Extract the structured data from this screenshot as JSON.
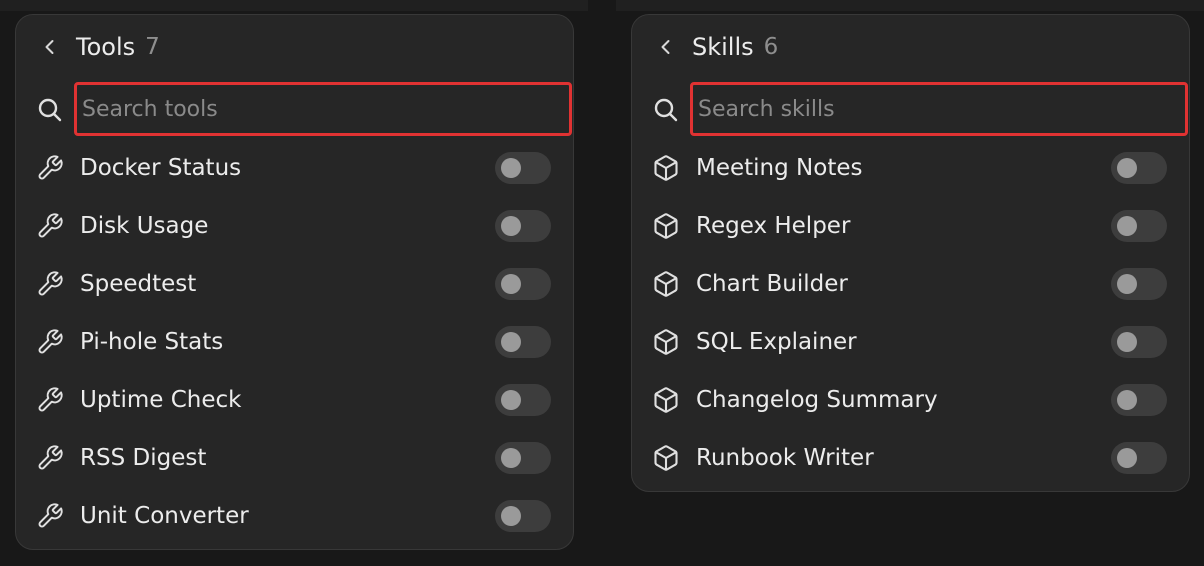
{
  "tools_panel": {
    "title": "Tools",
    "count": "7",
    "search_placeholder": "Search tools",
    "search_value": "",
    "item_icon": "wrench-icon",
    "items": [
      {
        "label": "Docker Status",
        "enabled": false
      },
      {
        "label": "Disk Usage",
        "enabled": false
      },
      {
        "label": "Speedtest",
        "enabled": false
      },
      {
        "label": "Pi-hole Stats",
        "enabled": false
      },
      {
        "label": "Uptime Check",
        "enabled": false
      },
      {
        "label": "RSS Digest",
        "enabled": false
      },
      {
        "label": "Unit Converter",
        "enabled": false
      }
    ]
  },
  "skills_panel": {
    "title": "Skills",
    "count": "6",
    "search_placeholder": "Search skills",
    "search_value": "",
    "item_icon": "cube-icon",
    "items": [
      {
        "label": "Meeting Notes",
        "enabled": false
      },
      {
        "label": "Regex Helper",
        "enabled": false
      },
      {
        "label": "Chart Builder",
        "enabled": false
      },
      {
        "label": "SQL Explainer",
        "enabled": false
      },
      {
        "label": "Changelog Summary",
        "enabled": false
      },
      {
        "label": "Runbook Writer",
        "enabled": false
      }
    ]
  },
  "colors": {
    "background": "#181818",
    "panel": "#262626",
    "highlight_outline": "#e03232",
    "toggle_off_track": "#3d3d3d",
    "toggle_off_knob": "#9a9a9a"
  }
}
